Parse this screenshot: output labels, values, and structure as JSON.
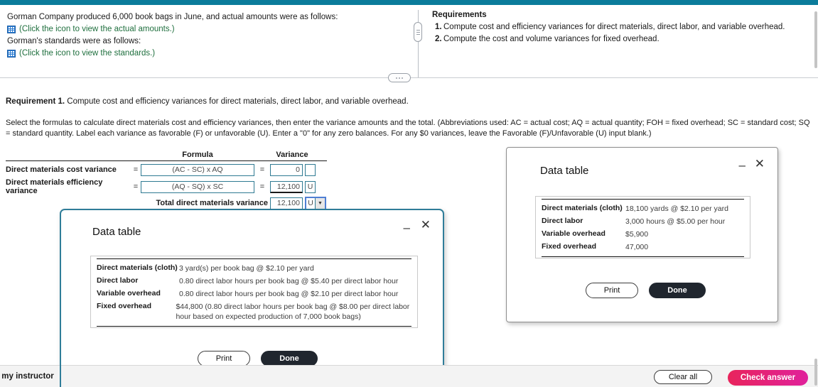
{
  "theme": {
    "accent_teal": "#0b7c9b",
    "dialog_border_active": "#2f7d99",
    "link_green": "#1f6f3e",
    "icon_blue": "#2d7dd2",
    "check_answer_gradient_start": "#e8245c",
    "check_answer_gradient_end": "#e0219b"
  },
  "question": {
    "intro": "Gorman Company produced 6,000 book bags in June, and actual amounts were as follows:",
    "intro_italic_word": "actual",
    "actual_link": "(Click the icon to view the actual amounts.)",
    "standards_intro": "Gorman's standards were as follows:",
    "standards_intro_italic_word": "standards",
    "standards_link": "(Click the icon to view the standards.)",
    "actual_icon": "table-grid-icon",
    "standards_icon": "table-grid-icon"
  },
  "requirements": {
    "title": "Requirements",
    "items": [
      {
        "num": "1.",
        "text": "Compute cost and efficiency variances for direct materials, direct labor, and variable overhead."
      },
      {
        "num": "2.",
        "text": "Compute the cost and volume variances for fixed overhead."
      }
    ]
  },
  "work": {
    "requirement_label": "Requirement 1.",
    "requirement_text": "Compute cost and efficiency variances for direct materials, direct labor, and variable overhead.",
    "instructions": "Select the formulas to calculate direct materials cost and efficiency variances, then enter the variance amounts and the total. (Abbreviations used: AC = actual cost; AQ = actual quantity; FOH = fixed overhead; SC = standard cost; SQ = standard quantity. Label each variance as favorable (F) or unfavorable (U). Enter a \"0\" for any zero balances. For any $0 variances, leave the Favorable (F)/Unfavorable (U) input blank.)"
  },
  "variance_table": {
    "headers": {
      "formula": "Formula",
      "variance": "Variance"
    },
    "equals": "=",
    "rows": [
      {
        "label": "Direct materials cost variance",
        "formula": "(AC - SC) x AQ",
        "amount": "0",
        "fu": ""
      },
      {
        "label": "Direct materials efficiency variance",
        "formula": "(AQ - SQ) x SC",
        "amount": "12,100",
        "fu": "U"
      }
    ],
    "total": {
      "label": "Total direct materials variance",
      "amount": "12,100",
      "fu": "U",
      "dropdown_arrow": "▼"
    }
  },
  "dialog_actual": {
    "title": "Data table",
    "minimize_icon": "minimize-icon",
    "close_icon": "close-icon",
    "rows": [
      {
        "key": "Direct materials (cloth)",
        "value": "18,100 yards @ $2.10 per yard"
      },
      {
        "key": "Direct labor",
        "value": "3,000 hours @ $5.00 per hour"
      },
      {
        "key": "Variable overhead",
        "value": "$5,900"
      },
      {
        "key": "Fixed overhead",
        "value": "47,000"
      }
    ],
    "print_label": "Print",
    "done_label": "Done"
  },
  "dialog_standards": {
    "title": "Data table",
    "minimize_icon": "minimize-icon",
    "close_icon": "close-icon",
    "rows": [
      {
        "key": "Direct materials (cloth)",
        "value": "3 yard(s) per book bag @ $2.10 per yard"
      },
      {
        "key": "Direct labor",
        "value": "0.80 direct labor hours per book bag @ $5.40 per direct labor hour"
      },
      {
        "key": "Variable overhead",
        "value": "0.80 direct labor hours per book bag @ $2.10 per direct labor hour"
      },
      {
        "key": "Fixed overhead",
        "value": "$44,800 (0.80 direct labor hours per book bag @ $8.00 per direct labor hour based on expected production of 7,000 book bags)"
      }
    ],
    "print_label": "Print",
    "done_label": "Done"
  },
  "bottom_bar": {
    "ask_instructor": "Ask my instructor",
    "clear_all": "Clear all",
    "check_answer": "Check answer"
  }
}
